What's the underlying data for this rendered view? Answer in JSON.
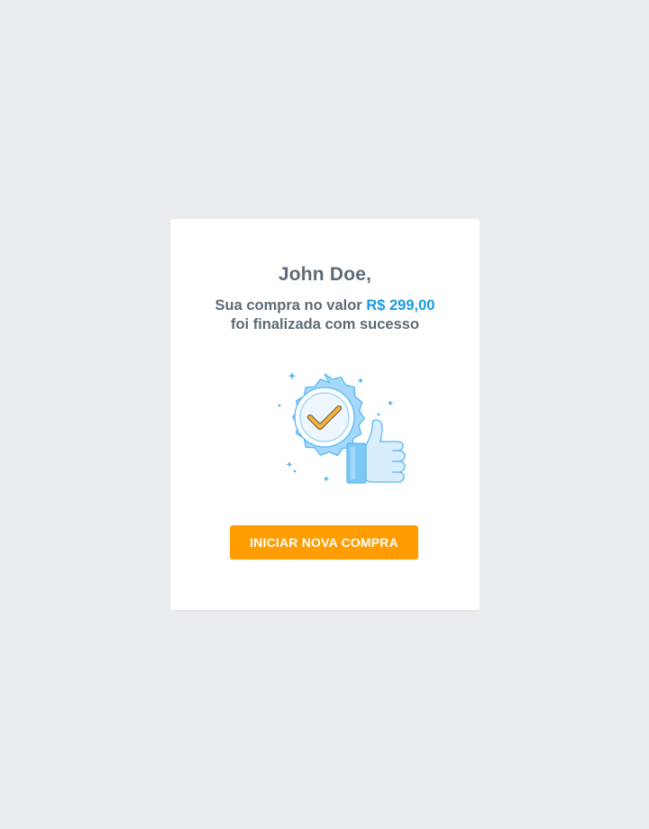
{
  "greeting": {
    "name": "John Doe,"
  },
  "message": {
    "prefix": "Sua compra no valor",
    "amount": "R$ 299,00",
    "suffix": "foi finalizada com sucesso"
  },
  "illustration": {
    "icon": "success-badge-thumbs-up-icon"
  },
  "actions": {
    "new_purchase_label": "INICIAR NOVA COMPRA"
  },
  "colors": {
    "background": "#e9edf0",
    "card": "#ffffff",
    "text": "#5d6b76",
    "amount": "#1a9be0",
    "button": "#ff9c00",
    "button_text": "#ffffff"
  }
}
